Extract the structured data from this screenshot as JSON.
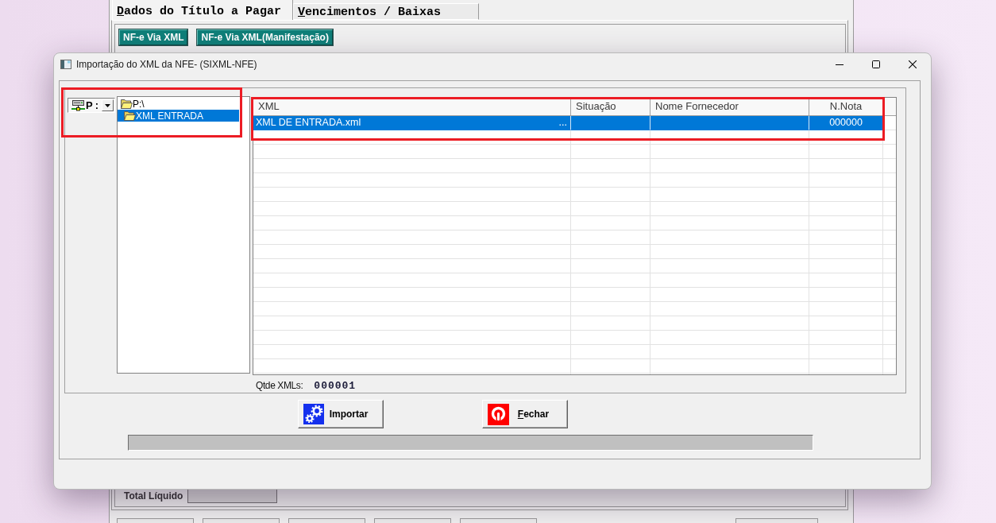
{
  "background_window": {
    "tabs": [
      {
        "label": "Dados do Título a Pagar",
        "selected": true,
        "mnemonic": true
      },
      {
        "label": "Vencimentos / Baixas",
        "selected": false,
        "mnemonic": true
      }
    ],
    "buttons": [
      {
        "label": "NF-e Via XML"
      },
      {
        "label": "NF-e Via XML(Manifestação)"
      }
    ],
    "total_label": "Total Líquido"
  },
  "dialog": {
    "title": "Importação do XML da NFE- (SIXML-NFE)",
    "browser": {
      "highlighted": true,
      "drive": "P:",
      "folders": [
        {
          "label": "P:\\",
          "selected": false,
          "children": [
            {
              "label": "XML ENTRADA",
              "selected": true
            }
          ]
        }
      ]
    },
    "table": {
      "highlighted": true,
      "columns": [
        "XML",
        "Situação",
        "Nome Fornecedor",
        "N.Nota"
      ],
      "rows": [
        {
          "xml": "XML DE ENTRADA.xml",
          "more_button": "...",
          "n_nota": "000000",
          "selected": true
        }
      ]
    },
    "count_label": "Qtde XMLs:",
    "count_value": "000001",
    "buttons": [
      {
        "label": "Importar",
        "kind": "import",
        "mnemonic": false
      },
      {
        "label": "Fechar",
        "kind": "close",
        "mnemonic": true
      }
    ]
  }
}
